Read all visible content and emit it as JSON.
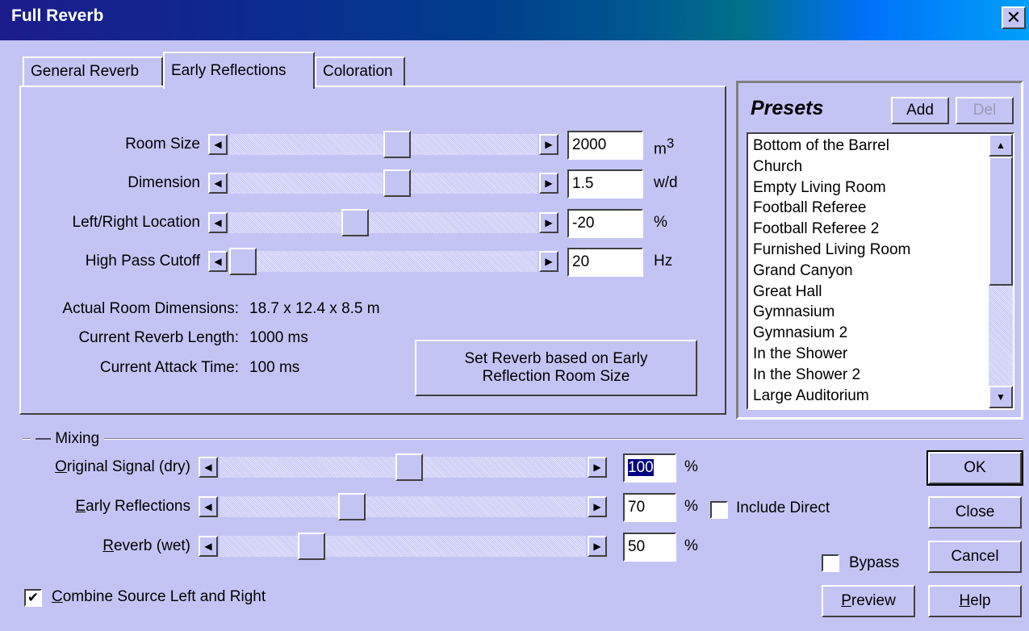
{
  "window": {
    "title": "Full Reverb",
    "close_glyph": "✕"
  },
  "tabs": [
    {
      "label": "General Reverb",
      "active": false
    },
    {
      "label": "Early Reflections",
      "active": true
    },
    {
      "label": "Coloration",
      "active": false
    }
  ],
  "early_reflections": {
    "sliders": [
      {
        "label": "Room Size",
        "value": "2000",
        "unit": "m",
        "unit_sup": "3",
        "level": 0.55
      },
      {
        "label": "Dimension",
        "value": "1.5",
        "unit": "w/d",
        "level": 0.55
      },
      {
        "label": "Left/Right Location",
        "value": "-20",
        "unit": "%",
        "level": 0.4
      },
      {
        "label": "High Pass Cutoff",
        "value": "20",
        "unit": "Hz",
        "level": 0.0
      }
    ],
    "info": [
      {
        "label": "Actual Room Dimensions:",
        "value": "18.7 x 12.4 x 8.5 m"
      },
      {
        "label": "Current Reverb Length:",
        "value": "1000 ms"
      },
      {
        "label": "Current Attack Time:",
        "value": "100 ms"
      }
    ],
    "set_reverb_button": "Set Reverb based on Early Reflection Room Size"
  },
  "presets": {
    "title": "Presets",
    "add_label": "Add",
    "del_label": "Del",
    "items": [
      "Bottom of the Barrel",
      "Church",
      "Empty Living Room",
      "Football Referee",
      "Football Referee 2",
      "Furnished Living Room",
      "Grand Canyon",
      "Great Hall",
      "Gymnasium",
      "Gymnasium 2",
      "In the Shower",
      "In the Shower 2",
      "Large Auditorium"
    ]
  },
  "mixing": {
    "group_label": "Mixing",
    "rows": [
      {
        "label": "Original Signal (dry)",
        "mnemonic": "O",
        "value": "100",
        "unit": "%",
        "level": 0.52
      },
      {
        "label": "Early Reflections",
        "mnemonic": "E",
        "value": "70",
        "unit": "%",
        "level": 0.35
      },
      {
        "label": "Reverb (wet)",
        "mnemonic": "R",
        "value": "50",
        "unit": "%",
        "level": 0.23
      }
    ],
    "include_direct_label": "Include Direct",
    "include_direct_checked": false,
    "combine_label": "Combine Source Left and Right",
    "combine_checked": true,
    "bypass_label": "Bypass",
    "bypass_checked": false
  },
  "buttons": {
    "ok": "OK",
    "close": "Close",
    "cancel": "Cancel",
    "help": "Help",
    "preview": "Preview"
  },
  "colors": {
    "face": "#c4c4f4",
    "title_start": "#1c1c8c",
    "title_end": "#00a0f8",
    "selection": "#000080"
  }
}
